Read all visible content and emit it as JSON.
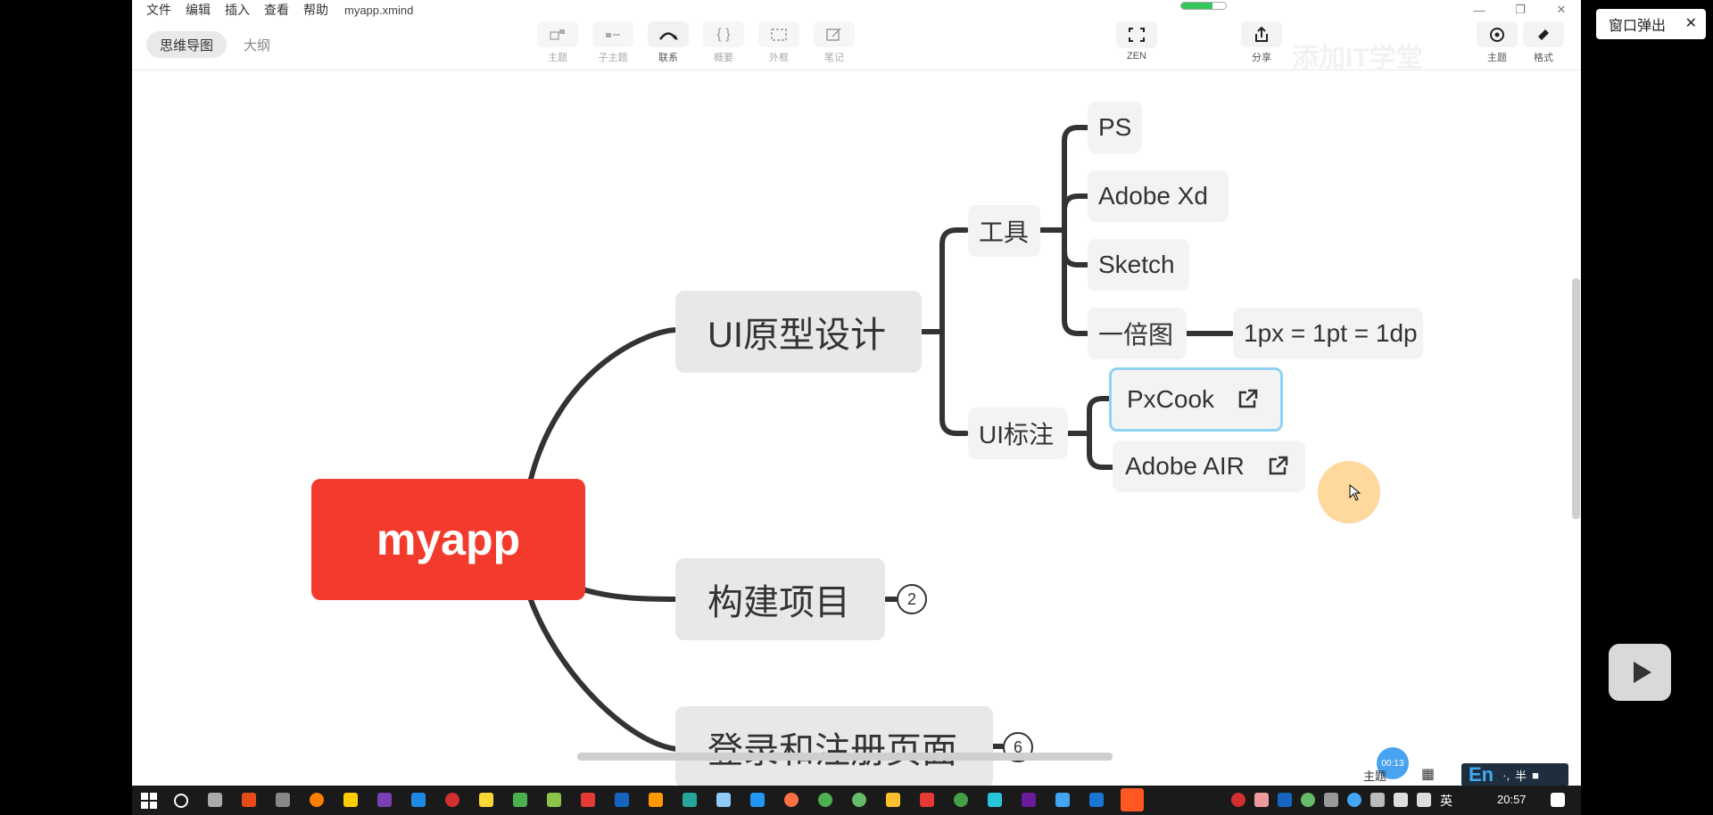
{
  "menu": [
    "文件",
    "编辑",
    "插入",
    "查看",
    "帮助"
  ],
  "file_name": "myapp.xmind",
  "title_progress": 0.7,
  "window_controls": {
    "minimize": "—",
    "maximize": "❐",
    "close": "✕"
  },
  "view_tabs": [
    {
      "label": "思维导图",
      "active": true
    },
    {
      "label": "大纲",
      "active": false
    }
  ],
  "toolbar": {
    "topic": "主题",
    "subtopic": "子主题",
    "relation": "联系",
    "summary": "概要",
    "boundary": "外框",
    "notes": "笔记",
    "zen": "ZEN",
    "share": "分享",
    "theme": "主题",
    "format": "格式"
  },
  "watermark": "添加IT学堂",
  "mindmap": {
    "root": "myapp",
    "branch_ui": "UI原型设计",
    "branch_build": "构建项目",
    "branch_login": "登录和注册页面",
    "tools": "工具",
    "tool_ps": "PS",
    "tool_xd": "Adobe Xd",
    "tool_sketch": "Sketch",
    "tool_onex": "一倍图",
    "onex_note": "1px = 1pt = 1dp",
    "annotate": "UI标注",
    "pxcook": "PxCook",
    "adobe_air": "Adobe AIR",
    "build_count": "2",
    "login_count": "6"
  },
  "status": {
    "timer": "00:13",
    "label": "主题"
  },
  "ime": {
    "mode": "En",
    "punct": "·,",
    "width": "半"
  },
  "popout": {
    "label": "窗口弹出",
    "close": "✕"
  },
  "clock": "20:57",
  "tray_lang": "英",
  "colors": {
    "root": "#f23b2c",
    "branch_bg": "#e8e8e8",
    "connector": "#333333",
    "selection": "#8fd2f4"
  }
}
